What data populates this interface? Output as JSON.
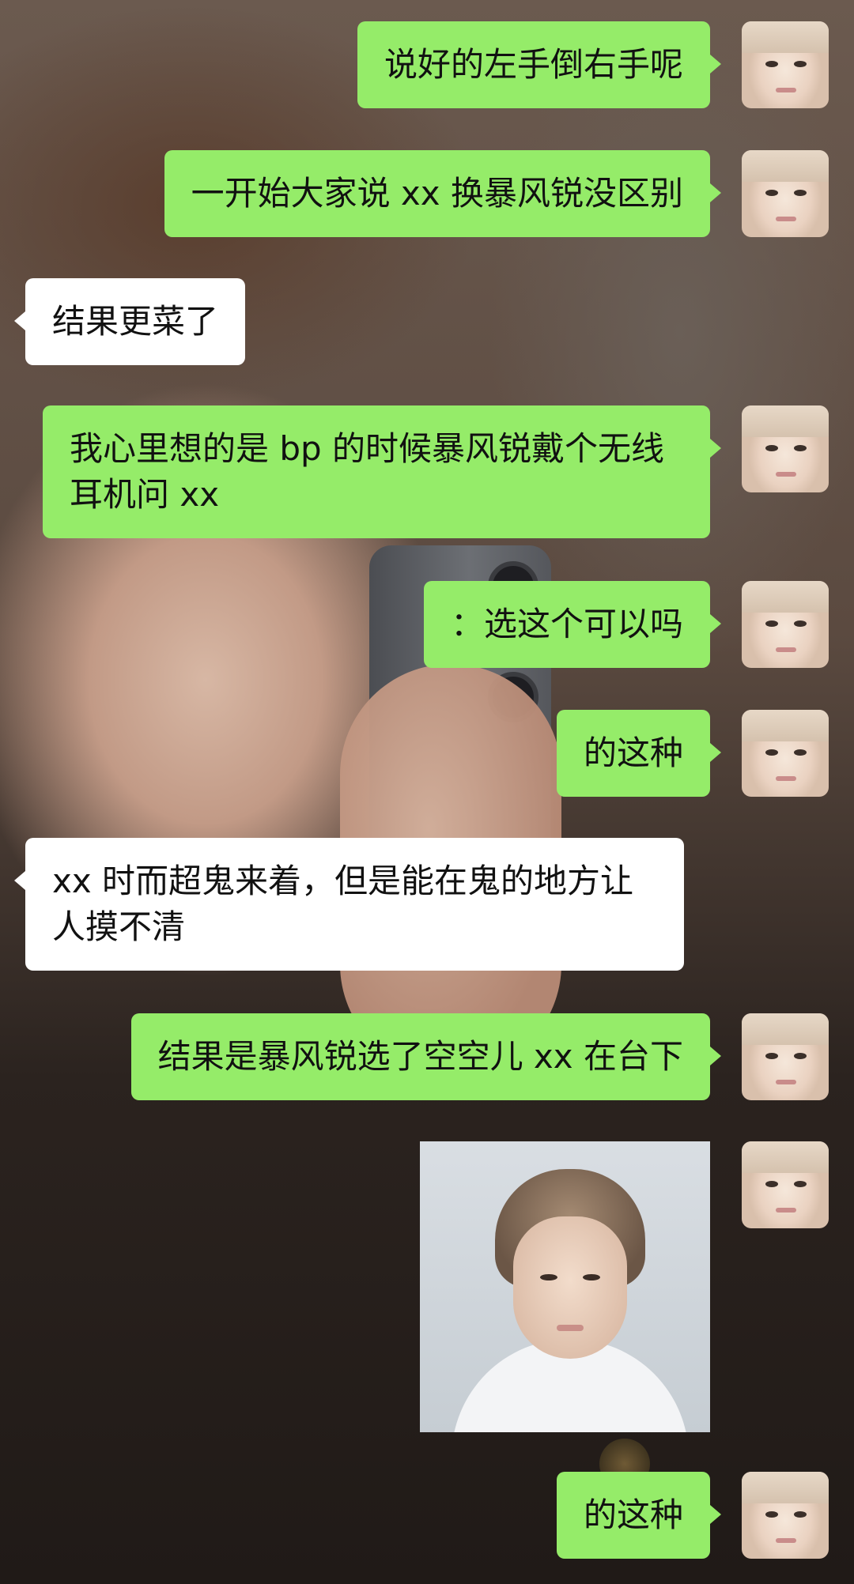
{
  "messages": [
    {
      "side": "right",
      "text": "说好的左手倒右手呢"
    },
    {
      "side": "right",
      "text": "一开始大家说 xx 换暴风锐没区别"
    },
    {
      "side": "left",
      "text": "结果更菜了"
    },
    {
      "side": "right",
      "text": "我心里想的是 bp 的时候暴风锐戴个无线耳机问 xx"
    },
    {
      "side": "right",
      "text": "：选这个可以吗"
    },
    {
      "side": "right",
      "text": "的这种"
    },
    {
      "side": "left",
      "text": "xx 时而超鬼来着，但是能在鬼的地方让人摸不清"
    },
    {
      "side": "right",
      "text": "结果是暴风锐选了空空儿 xx 在台下"
    },
    {
      "side": "right",
      "type": "image"
    },
    {
      "side": "right",
      "text": "的这种"
    }
  ],
  "colors": {
    "self_bubble": "#95ec69",
    "other_bubble": "#ffffff"
  }
}
